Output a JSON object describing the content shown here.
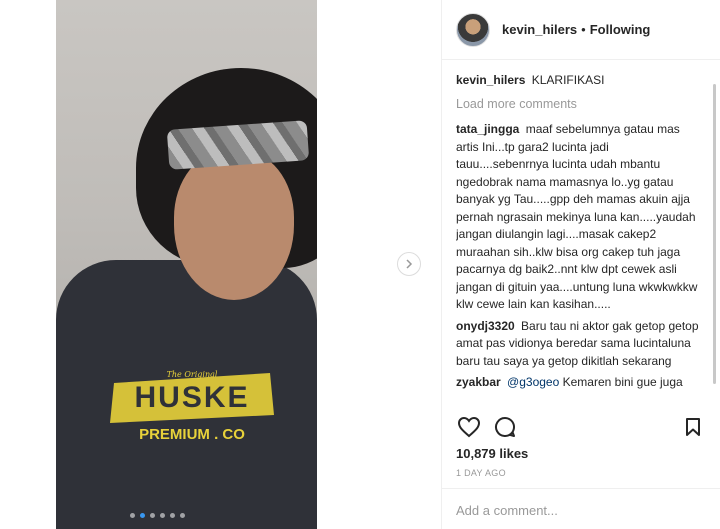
{
  "post": {
    "author": "kevin_hilers",
    "separator": "•",
    "follow_status": "Following",
    "caption_user": "kevin_hilers",
    "caption_text": "KLARIFIKASI",
    "load_more": "Load more comments",
    "likes": "10,879 likes",
    "time_ago": "1 DAY AGO",
    "add_comment_placeholder": "Add a comment...",
    "carousel_count": 6,
    "carousel_active_index": 1
  },
  "comments": [
    {
      "user": "tata_jingga",
      "text": "maaf sebelumnya gatau mas artis Ini...tp gara2 lucinta jadi tauu....sebenrnya lucinta udah mbantu ngedobrak nama mamasnya lo..yg gatau banyak yg Tau.....gpp deh mamas akuin ajja pernah ngrasain mekinya luna kan.....yaudah jangan diulangin lagi....masak cakep2 muraahan sih..klw bisa org cakep tuh jaga pacarnya dg baik2..nnt klw dpt cewek asli jangan di gituin yaa....untung luna wkwkwkkw klw cewe lain kan kasihan....."
    },
    {
      "user": "onydj3320",
      "text": "Baru tau ni aktor gak getop getop amat pas vidionya beredar sama lucintaluna baru tau saya ya getop dikitlah sekarang"
    },
    {
      "user": "zyakbar",
      "mention": "@g3ogeo",
      "text": "Kemaren bini gue juga"
    }
  ],
  "photo_print": {
    "line1": "The Original",
    "brand": "HUSKE",
    "line2": "PREMIUM . CO"
  },
  "icons": {
    "heart": "heart-icon",
    "comment": "comment-icon",
    "bookmark": "bookmark-icon",
    "next": "chevron-right-icon"
  },
  "colors": {
    "accent_blue": "#3897f0",
    "text": "#262626",
    "muted": "#999999",
    "print_yellow": "#e8d23a"
  }
}
